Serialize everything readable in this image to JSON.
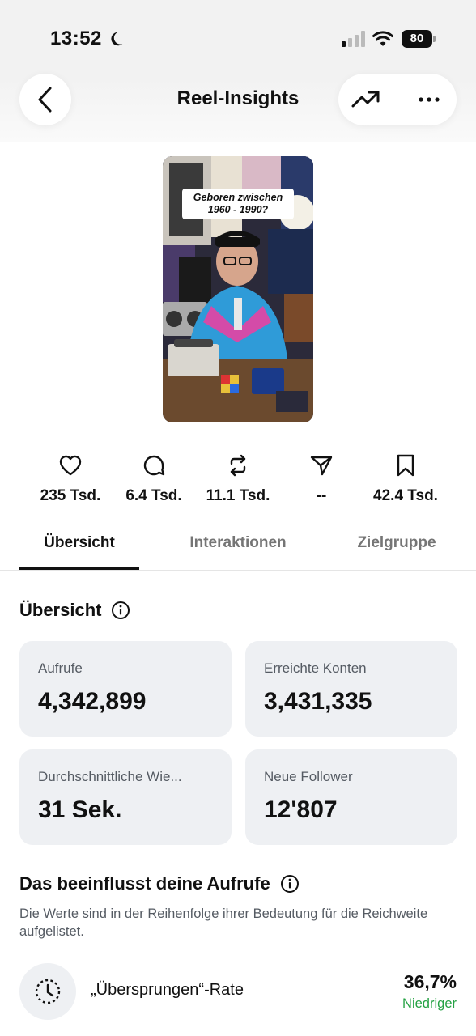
{
  "status_bar": {
    "time": "13:52",
    "battery": "80"
  },
  "header": {
    "title": "Reel-Insights"
  },
  "thumbnail": {
    "caption_line1": "Geboren zwischen",
    "caption_line2": "1960 - 1990?"
  },
  "metrics": [
    {
      "icon": "heart-icon",
      "value": "235 Tsd."
    },
    {
      "icon": "comment-icon",
      "value": "6.4 Tsd."
    },
    {
      "icon": "repost-icon",
      "value": "11.1 Tsd."
    },
    {
      "icon": "share-icon",
      "value": "--"
    },
    {
      "icon": "bookmark-icon",
      "value": "42.4 Tsd."
    }
  ],
  "tabs": [
    {
      "label": "Übersicht",
      "active": true
    },
    {
      "label": "Interaktionen",
      "active": false
    },
    {
      "label": "Zielgruppe",
      "active": false
    }
  ],
  "overview": {
    "title": "Übersicht",
    "cards": [
      {
        "label": "Aufrufe",
        "value": "4,342,899"
      },
      {
        "label": "Erreichte Konten",
        "value": "3,431,335"
      },
      {
        "label": "Durchschnittliche Wie...",
        "value": "31 Sek."
      },
      {
        "label": "Neue Follower",
        "value": "12'807"
      }
    ]
  },
  "influence": {
    "title": "Das beeinflusst deine Aufrufe",
    "description": "Die Werte sind in der Reihenfolge ihrer Bedeutung für die Reichweite aufgelistet.",
    "factors": [
      {
        "label": "„Übersprungen“-Rate",
        "value": "36,7%",
        "status": "Niedriger",
        "status_color": "#25a244"
      }
    ]
  }
}
